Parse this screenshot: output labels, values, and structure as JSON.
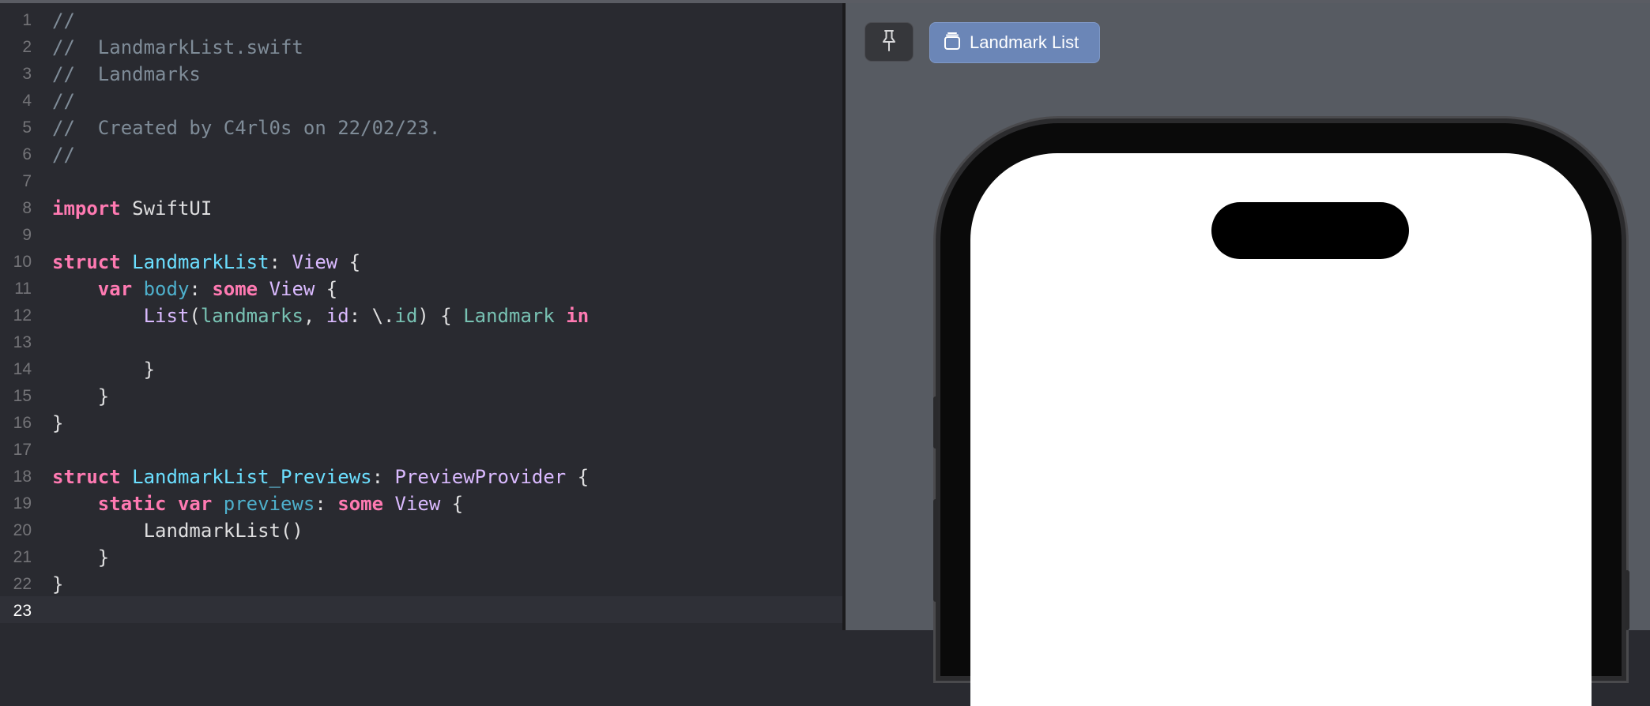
{
  "editor": {
    "current_line": 23,
    "lines": [
      {
        "num": "1",
        "tokens": [
          {
            "t": "//",
            "k": "comment"
          }
        ]
      },
      {
        "num": "2",
        "tokens": [
          {
            "t": "//  LandmarkList.swift",
            "k": "comment"
          }
        ]
      },
      {
        "num": "3",
        "tokens": [
          {
            "t": "//  Landmarks",
            "k": "comment"
          }
        ]
      },
      {
        "num": "4",
        "tokens": [
          {
            "t": "//",
            "k": "comment"
          }
        ]
      },
      {
        "num": "5",
        "tokens": [
          {
            "t": "//  Created by C4rl0s on 22/02/23.",
            "k": "comment"
          }
        ]
      },
      {
        "num": "6",
        "tokens": [
          {
            "t": "//",
            "k": "comment"
          }
        ]
      },
      {
        "num": "7",
        "tokens": []
      },
      {
        "num": "8",
        "tokens": [
          {
            "t": "import",
            "k": "kw"
          },
          {
            "t": " SwiftUI",
            "k": "plain"
          }
        ]
      },
      {
        "num": "9",
        "tokens": []
      },
      {
        "num": "10",
        "tokens": [
          {
            "t": "struct",
            "k": "kw"
          },
          {
            "t": " ",
            "k": "plain"
          },
          {
            "t": "LandmarkList",
            "k": "tdecl"
          },
          {
            "t": ": ",
            "k": "plain"
          },
          {
            "t": "View",
            "k": "type"
          },
          {
            "t": " {",
            "k": "plain"
          }
        ]
      },
      {
        "num": "11",
        "tokens": [
          {
            "t": "    ",
            "k": "plain"
          },
          {
            "t": "var",
            "k": "kw"
          },
          {
            "t": " ",
            "k": "plain"
          },
          {
            "t": "body",
            "k": "var"
          },
          {
            "t": ": ",
            "k": "plain"
          },
          {
            "t": "some",
            "k": "kw"
          },
          {
            "t": " ",
            "k": "plain"
          },
          {
            "t": "View",
            "k": "type"
          },
          {
            "t": " {",
            "k": "plain"
          }
        ]
      },
      {
        "num": "12",
        "tokens": [
          {
            "t": "        ",
            "k": "plain"
          },
          {
            "t": "List",
            "k": "type"
          },
          {
            "t": "(",
            "k": "plain"
          },
          {
            "t": "landmarks",
            "k": "ident"
          },
          {
            "t": ", ",
            "k": "plain"
          },
          {
            "t": "id",
            "k": "type"
          },
          {
            "t": ": \\.",
            "k": "plain"
          },
          {
            "t": "id",
            "k": "ident"
          },
          {
            "t": ") { ",
            "k": "plain"
          },
          {
            "t": "Landmark",
            "k": "ident"
          },
          {
            "t": " ",
            "k": "plain"
          },
          {
            "t": "in",
            "k": "kw"
          }
        ]
      },
      {
        "num": "13",
        "tokens": []
      },
      {
        "num": "14",
        "tokens": [
          {
            "t": "        }",
            "k": "plain"
          }
        ]
      },
      {
        "num": "15",
        "tokens": [
          {
            "t": "    }",
            "k": "plain"
          }
        ]
      },
      {
        "num": "16",
        "tokens": [
          {
            "t": "}",
            "k": "plain"
          }
        ]
      },
      {
        "num": "17",
        "tokens": []
      },
      {
        "num": "18",
        "tokens": [
          {
            "t": "struct",
            "k": "kw"
          },
          {
            "t": " ",
            "k": "plain"
          },
          {
            "t": "LandmarkList_Previews",
            "k": "tdecl"
          },
          {
            "t": ": ",
            "k": "plain"
          },
          {
            "t": "PreviewProvider",
            "k": "type"
          },
          {
            "t": " {",
            "k": "plain"
          }
        ]
      },
      {
        "num": "19",
        "tokens": [
          {
            "t": "    ",
            "k": "plain"
          },
          {
            "t": "static",
            "k": "kw"
          },
          {
            "t": " ",
            "k": "plain"
          },
          {
            "t": "var",
            "k": "kw"
          },
          {
            "t": " ",
            "k": "plain"
          },
          {
            "t": "previews",
            "k": "var"
          },
          {
            "t": ": ",
            "k": "plain"
          },
          {
            "t": "some",
            "k": "kw"
          },
          {
            "t": " ",
            "k": "plain"
          },
          {
            "t": "View",
            "k": "type"
          },
          {
            "t": " {",
            "k": "plain"
          }
        ]
      },
      {
        "num": "20",
        "tokens": [
          {
            "t": "        ",
            "k": "plain"
          },
          {
            "t": "LandmarkList",
            "k": "plain"
          },
          {
            "t": "()",
            "k": "plain"
          }
        ]
      },
      {
        "num": "21",
        "tokens": [
          {
            "t": "    }",
            "k": "plain"
          }
        ]
      },
      {
        "num": "22",
        "tokens": [
          {
            "t": "}",
            "k": "plain"
          }
        ]
      },
      {
        "num": "23",
        "tokens": []
      }
    ]
  },
  "preview": {
    "pin_icon": "pin-icon",
    "selector_icon": "stack-icon",
    "selector_label": "Landmark List",
    "device": "iPhone"
  },
  "colors": {
    "editor_bg": "#292a30",
    "canvas_bg": "#575b62",
    "keyword": "#ff7ab2",
    "type_decl": "#6bdfff",
    "type": "#dabaff",
    "comment": "#7f8c98",
    "chip_accent": "#6b86b7"
  }
}
